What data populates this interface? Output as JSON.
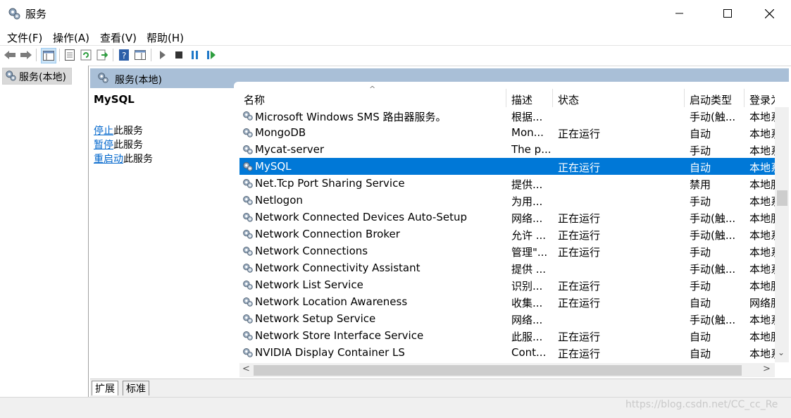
{
  "window": {
    "title": "服务",
    "icon": "gears-icon",
    "controls": {
      "minimize": "minimize-icon",
      "maximize": "maximize-icon",
      "close": "close-icon"
    }
  },
  "menu": [
    {
      "label": "文件(F)"
    },
    {
      "label": "操作(A)"
    },
    {
      "label": "查看(V)"
    },
    {
      "label": "帮助(H)"
    }
  ],
  "toolbar": {
    "icons": [
      "back-icon",
      "forward-icon",
      "show-hide-tree-icon",
      "properties-icon",
      "refresh-icon",
      "export-list-icon",
      "help-icon",
      "show-hide-action-pane-icon",
      "start-service-icon",
      "stop-service-icon",
      "pause-service-icon",
      "resume-service-icon"
    ]
  },
  "tree": {
    "label": "服务(本地)"
  },
  "content_header": {
    "label": "服务(本地)"
  },
  "selected_service": {
    "name": "MySQL",
    "actions": [
      {
        "link": "停止",
        "rest": "此服务"
      },
      {
        "link": "暂停",
        "rest": "此服务"
      },
      {
        "link": "重启动",
        "rest": "此服务"
      }
    ]
  },
  "columns": {
    "name": "名称",
    "description": "描述",
    "status": "状态",
    "startup": "启动类型",
    "logon": "登录为"
  },
  "services": [
    {
      "name": "Microsoft Windows SMS 路由器服务。",
      "description": "根据...",
      "status": "",
      "startup": "手动(触...",
      "logon": "本地系统"
    },
    {
      "name": "MongoDB",
      "description": "Mon...",
      "status": "正在运行",
      "startup": "自动",
      "logon": "本地系统"
    },
    {
      "name": "Mycat-server",
      "description": "The p...",
      "status": "",
      "startup": "手动",
      "logon": "本地系统"
    },
    {
      "name": "MySQL",
      "description": "",
      "status": "正在运行",
      "startup": "自动",
      "logon": "本地系统"
    },
    {
      "name": "Net.Tcp Port Sharing Service",
      "description": "提供...",
      "status": "",
      "startup": "禁用",
      "logon": "本地服务"
    },
    {
      "name": "Netlogon",
      "description": "为用...",
      "status": "",
      "startup": "手动",
      "logon": "本地系统"
    },
    {
      "name": "Network Connected Devices Auto-Setup",
      "description": "网络...",
      "status": "正在运行",
      "startup": "手动(触...",
      "logon": "本地服务"
    },
    {
      "name": "Network Connection Broker",
      "description": "允许 ...",
      "status": "正在运行",
      "startup": "手动(触...",
      "logon": "本地系统"
    },
    {
      "name": "Network Connections",
      "description": "管理\"...",
      "status": "正在运行",
      "startup": "手动",
      "logon": "本地系统"
    },
    {
      "name": "Network Connectivity Assistant",
      "description": "提供 ...",
      "status": "",
      "startup": "手动(触...",
      "logon": "本地系统"
    },
    {
      "name": "Network List Service",
      "description": "识别...",
      "status": "正在运行",
      "startup": "手动",
      "logon": "本地服务"
    },
    {
      "name": "Network Location Awareness",
      "description": "收集...",
      "status": "正在运行",
      "startup": "自动",
      "logon": "网络服务"
    },
    {
      "name": "Network Setup Service",
      "description": "网络...",
      "status": "",
      "startup": "手动(触...",
      "logon": "本地系统"
    },
    {
      "name": "Network Store Interface Service",
      "description": "此服...",
      "status": "正在运行",
      "startup": "自动",
      "logon": "本地服务"
    },
    {
      "name": "NVIDIA Display Container LS",
      "description": "Cont...",
      "status": "正在运行",
      "startup": "自动",
      "logon": "本地系统"
    }
  ],
  "selected_index": 3,
  "tabs": [
    {
      "label": "扩展",
      "active": true
    },
    {
      "label": "标准",
      "active": false
    }
  ],
  "watermark": "https://blog.csdn.net/CC_cc_Re",
  "colors": {
    "selection": "#0078d7",
    "header": "#a9bfd7",
    "link": "#0066cc"
  }
}
